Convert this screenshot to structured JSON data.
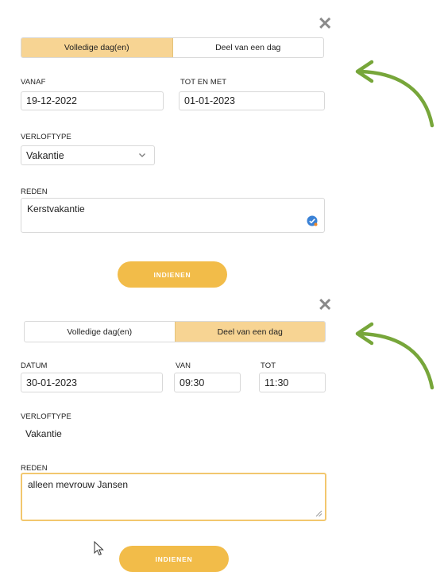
{
  "form1": {
    "toggle": {
      "full_day": "Volledige dag(en)",
      "part_day": "Deel van een dag"
    },
    "from": {
      "label": "VANAF",
      "value": "19-12-2022"
    },
    "until": {
      "label": "TOT EN MET",
      "value": "01-01-2023"
    },
    "leave_type": {
      "label": "VERLOFTYPE",
      "value": "Vakantie"
    },
    "reason": {
      "label": "REDEN",
      "value": "Kerstvakantie"
    },
    "submit": "INDIENEN"
  },
  "form2": {
    "toggle": {
      "full_day": "Volledige dag(en)",
      "part_day": "Deel van een dag"
    },
    "date": {
      "label": "DATUM",
      "value": "30-01-2023"
    },
    "from": {
      "label": "VAN",
      "value": "09:30"
    },
    "to": {
      "label": "TOT",
      "value": "11:30"
    },
    "leave_type": {
      "label": "VERLOFTYPE",
      "value": "Vakantie"
    },
    "reason": {
      "label": "REDEN",
      "value": "alleen mevrouw Jansen"
    },
    "submit": "INDIENEN"
  },
  "colors": {
    "accent": "#f2bc49",
    "active_segment": "#f7d493",
    "arrow": "#77a63a"
  },
  "icons": [
    "close-icon",
    "chevron-down-icon",
    "grammar-check-icon",
    "resize-grip-icon",
    "mouse-cursor-icon",
    "curved-arrow-icon"
  ]
}
